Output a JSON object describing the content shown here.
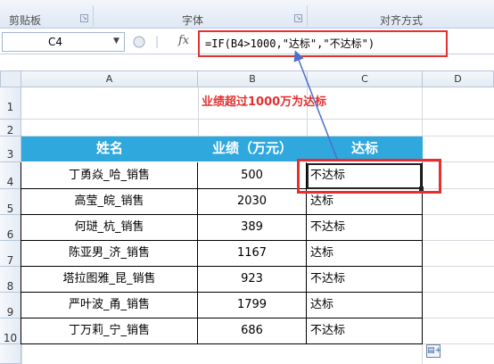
{
  "ribbon": {
    "groups": [
      {
        "name": "clipboard",
        "label": "剪贴板"
      },
      {
        "name": "font",
        "label": "字体"
      },
      {
        "name": "alignment",
        "label": "对齐方式"
      }
    ]
  },
  "formula_bar": {
    "name_box": "C4",
    "fx_label": "fx",
    "formula": "=IF(B4>1000,\"达标\",\"不达标\")"
  },
  "sheet": {
    "columns": [
      "A",
      "B",
      "C",
      "D"
    ],
    "rows": [
      "1",
      "2",
      "3",
      "4",
      "5",
      "6",
      "7",
      "8",
      "9",
      "10"
    ],
    "annotation": "业绩超过1000万为达标",
    "table": {
      "headers": [
        "姓名",
        "业绩（万元）",
        "达标"
      ],
      "rows": [
        {
          "name": "丁勇焱_哈_销售",
          "value": "500",
          "status": "不达标"
        },
        {
          "name": "高莹_皖_销售",
          "value": "2030",
          "status": "达标"
        },
        {
          "name": "何琎_杭_销售",
          "value": "389",
          "status": "不达标"
        },
        {
          "name": "陈亚男_济_销售",
          "value": "1167",
          "status": "达标"
        },
        {
          "name": "塔拉图雅_昆_销售",
          "value": "923",
          "status": "不达标"
        },
        {
          "name": "严叶波_甬_销售",
          "value": "1799",
          "status": "达标"
        },
        {
          "name": "丁万莉_宁_销售",
          "value": "686",
          "status": "不达标"
        }
      ]
    }
  },
  "colors": {
    "header_fill": "#2fa8dd",
    "highlight_red": "#e53030",
    "arrow_blue": "#4a6fd0"
  }
}
